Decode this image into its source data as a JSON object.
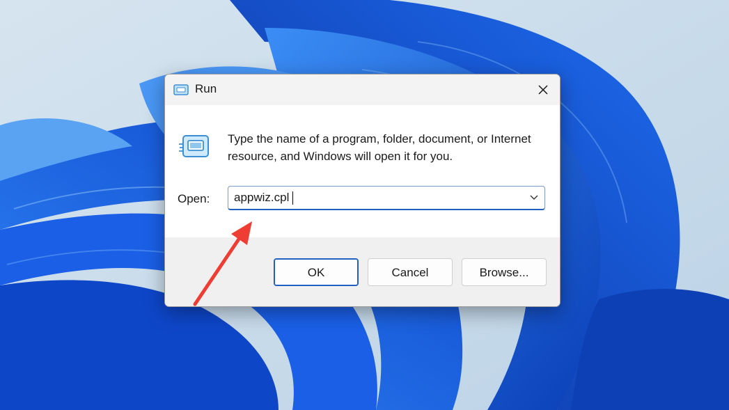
{
  "dialog": {
    "title": "Run",
    "description": "Type the name of a program, folder, document, or Internet resource, and Windows will open it for you.",
    "open_label": "Open:",
    "open_value": "appwiz.cpl",
    "buttons": {
      "ok": "OK",
      "cancel": "Cancel",
      "browse": "Browse..."
    }
  },
  "icons": {
    "title_icon": "run-app-icon",
    "big_icon": "run-app-icon",
    "close": "close-icon",
    "dropdown": "chevron-down-icon",
    "annotation": "red-arrow-icon"
  },
  "colors": {
    "accent": "#1f5fbf",
    "annotation_arrow": "#ee3d33",
    "wallpaper_blue": "#1565e0"
  }
}
